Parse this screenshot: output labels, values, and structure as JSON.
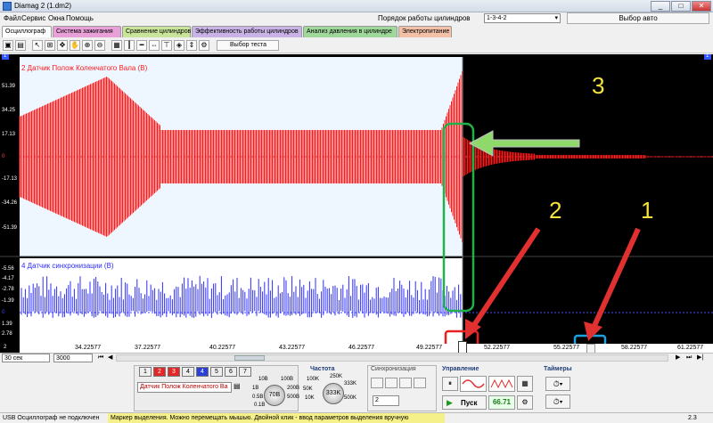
{
  "window": {
    "title": "Diamag 2 (1.dm2)",
    "minimize": "_",
    "maximize": "□",
    "close": "✕"
  },
  "menu": {
    "items": [
      "Файл",
      "Сервис",
      "Окна",
      "Помощь"
    ],
    "cyl_order_label": "Порядок работы цилиндров",
    "cyl_order_value": "1-3-4-2",
    "auto_select": "Выбор авто"
  },
  "tabs": [
    {
      "label": "Осциллограф",
      "color": "#ffffff"
    },
    {
      "label": "Система зажигания",
      "color": "#e9a0d8"
    },
    {
      "label": "Сравнение цилиндров",
      "color": "#c9e59a"
    },
    {
      "label": "Эффективность работы цилиндров",
      "color": "#c9b3e6"
    },
    {
      "label": "Анализ давления в цилиндре",
      "color": "#9fd89a"
    },
    {
      "label": "Электропитание",
      "color": "#f3c0a8"
    }
  ],
  "toolbar": {
    "test_select": "Выбор теста"
  },
  "channels": {
    "ch2": {
      "label": "2 Датчик Полож Коленчатого Вала (В)",
      "color": "#ff1a1a",
      "ticks": [
        "51.39",
        "34.25",
        "17.13",
        "0",
        "-17.13",
        "-34.26",
        "-51.39"
      ]
    },
    "ch4": {
      "label": "4 Датчик синхронизации (В)",
      "color": "#2d2dff",
      "ticks": [
        "-5.56",
        "-4.17",
        "-2.78",
        "-1.39",
        "0",
        "1.39",
        "2.78"
      ]
    }
  },
  "xaxis": {
    "ticks": [
      "34.22577",
      "37.22577",
      "40.22577",
      "43.22577",
      "46.22577",
      "49.22577",
      "52.22577",
      "55.22577",
      "58.22577",
      "61.22577"
    ]
  },
  "cursor_markers": {
    "top_left": "1",
    "top_right": "1",
    "bottom_left": "2"
  },
  "annotations": {
    "a1": "1",
    "a2": "2",
    "a3": "3"
  },
  "bottombar": {
    "time_scale": "30 сек",
    "samples": "3000"
  },
  "panel": {
    "channel_buttons": [
      "1",
      "2",
      "3",
      "4",
      "5",
      "6",
      "7",
      "8"
    ],
    "channel_select": "Датчик Полож Коленчатого Ва",
    "voltage_knob_labels": [
      "10B",
      "20B",
      "1B",
      "100B",
      "0.5B",
      "200B",
      "0.1B",
      "500B"
    ],
    "voltage_value": "70B",
    "freq_title": "Частота",
    "freq_labels": [
      "100K",
      "250K",
      "50K",
      "333K",
      "10K",
      "500K"
    ],
    "freq_value": "333K",
    "sync_title": "Синхронизация",
    "sync_value": "2",
    "control_title": "Управление",
    "start_label": "Пуск",
    "rate_value": "66.71",
    "timers_title": "Таймеры"
  },
  "status": {
    "usb": "USB Осциллограф не подключен",
    "hint": "Маркер выделения. Можно перемещать мышью. Двойной клик - ввод параметров выделения вручную",
    "version": "2.3"
  }
}
